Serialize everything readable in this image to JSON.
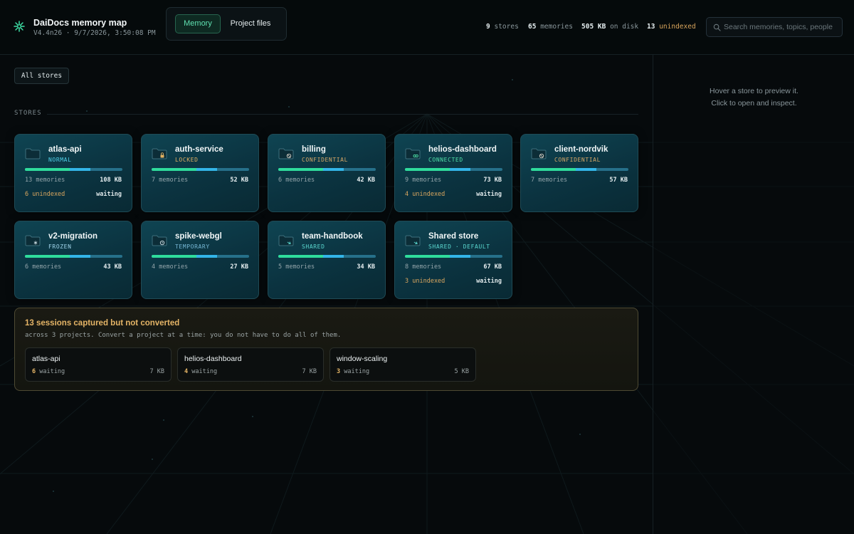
{
  "header": {
    "title": "DaiDocs memory map",
    "subtitle": "V4.4n26 · 9/7/2026, 3:50:08 PM",
    "tabs": [
      {
        "label": "Memory",
        "active": true
      },
      {
        "label": "Project files",
        "active": false
      }
    ],
    "stats": {
      "stores_count": "9",
      "stores_label": "stores",
      "memories_count": "65",
      "memories_label": "memories",
      "disk_count": "505 KB",
      "disk_label": "on disk",
      "unindexed_count": "13",
      "unindexed_label": "unindexed"
    },
    "search": {
      "placeholder": "Search memories, topics, people",
      "value": ""
    }
  },
  "filter": {
    "label": "All stores"
  },
  "stores_section": {
    "label": "STORES"
  },
  "stores": [
    {
      "name": "atlas-api",
      "status": "NORMAL",
      "memories": "13 memories",
      "size": "108 KB",
      "unindexed": "6 unindexed",
      "waiting": "waiting",
      "fill": 0.67
    },
    {
      "name": "auth-service",
      "status": "LOCKED",
      "memories": "7 memories",
      "size": "52 KB",
      "unindexed": "",
      "waiting": "",
      "fill": 0.67
    },
    {
      "name": "billing",
      "status": "CONFIDENTIAL",
      "memories": "6 memories",
      "size": "42 KB",
      "unindexed": "",
      "waiting": "",
      "fill": 0.67
    },
    {
      "name": "helios-dashboard",
      "status": "CONNECTED",
      "memories": "9 memories",
      "size": "73 KB",
      "unindexed": "4 unindexed",
      "waiting": "waiting",
      "fill": 0.67
    },
    {
      "name": "client-nordvik",
      "status": "CONFIDENTIAL",
      "memories": "7 memories",
      "size": "57 KB",
      "unindexed": "",
      "waiting": "",
      "fill": 0.67
    },
    {
      "name": "v2-migration",
      "status": "FROZEN",
      "memories": "6 memories",
      "size": "43 KB",
      "unindexed": "",
      "waiting": "",
      "fill": 0.67
    },
    {
      "name": "spike-webgl",
      "status": "TEMPORARY",
      "memories": "4 memories",
      "size": "27 KB",
      "unindexed": "",
      "waiting": "",
      "fill": 0.67
    },
    {
      "name": "team-handbook",
      "status": "SHARED",
      "memories": "5 memories",
      "size": "34 KB",
      "unindexed": "",
      "waiting": "",
      "fill": 0.67
    },
    {
      "name": "Shared store",
      "status": "SHARED · DEFAULT",
      "memories": "8 memories",
      "size": "67 KB",
      "unindexed": "3 unindexed",
      "waiting": "waiting",
      "fill": 0.67
    }
  ],
  "sessions": {
    "title": "13 sessions captured but not converted",
    "subtitle": "across 3 projects. Convert a project at a time: you do not have to do all of them.",
    "projects": [
      {
        "name": "atlas-api",
        "count": "6",
        "label": "waiting",
        "size": "7 KB"
      },
      {
        "name": "helios-dashboard",
        "count": "4",
        "label": "waiting",
        "size": "7 KB"
      },
      {
        "name": "window-scaling",
        "count": "3",
        "label": "waiting",
        "size": "5 KB"
      }
    ]
  },
  "side_panel": {
    "hint_line1": "Hover a store to preview it.",
    "hint_line2": "Click to open and inspect."
  },
  "colors": {
    "accent": "#2fdc9c",
    "secondary": "#33b5e8",
    "warning": "#dba75f",
    "card_bg": "#0c3a47",
    "background": "#060a0c"
  }
}
